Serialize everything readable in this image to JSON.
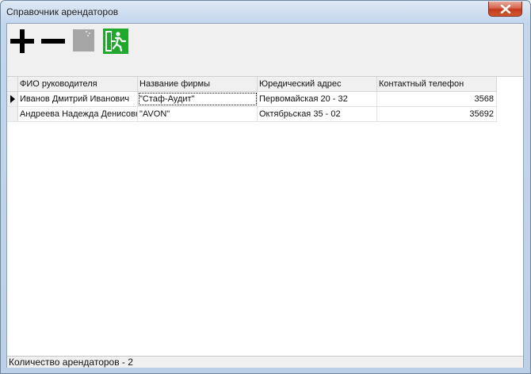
{
  "window": {
    "title": "Справочник арендаторов"
  },
  "toolbar": {
    "buttons": [
      {
        "icon": "plus-icon"
      },
      {
        "icon": "minus-icon"
      },
      {
        "icon": "document-icon"
      },
      {
        "icon": "exit-icon"
      }
    ]
  },
  "grid": {
    "columns": [
      "ФИО  руководителя",
      "Название фирмы",
      "Юредический адрес",
      "Контактный телефон"
    ],
    "rows": [
      [
        "Иванов Дмитрий Иванович",
        "\"Стаф-Аудит\"",
        "Первомайская 20 - 32",
        "3568"
      ],
      [
        "Андреева Надежда Денисовна",
        "\"AVON\"",
        "Октябрьская 35 - 02",
        "35692"
      ]
    ]
  },
  "status": {
    "text": "Количество арендаторов - 2"
  },
  "colors": {
    "exit_icon_green": "#1fa82b",
    "close_button_red": "#c1391c"
  }
}
